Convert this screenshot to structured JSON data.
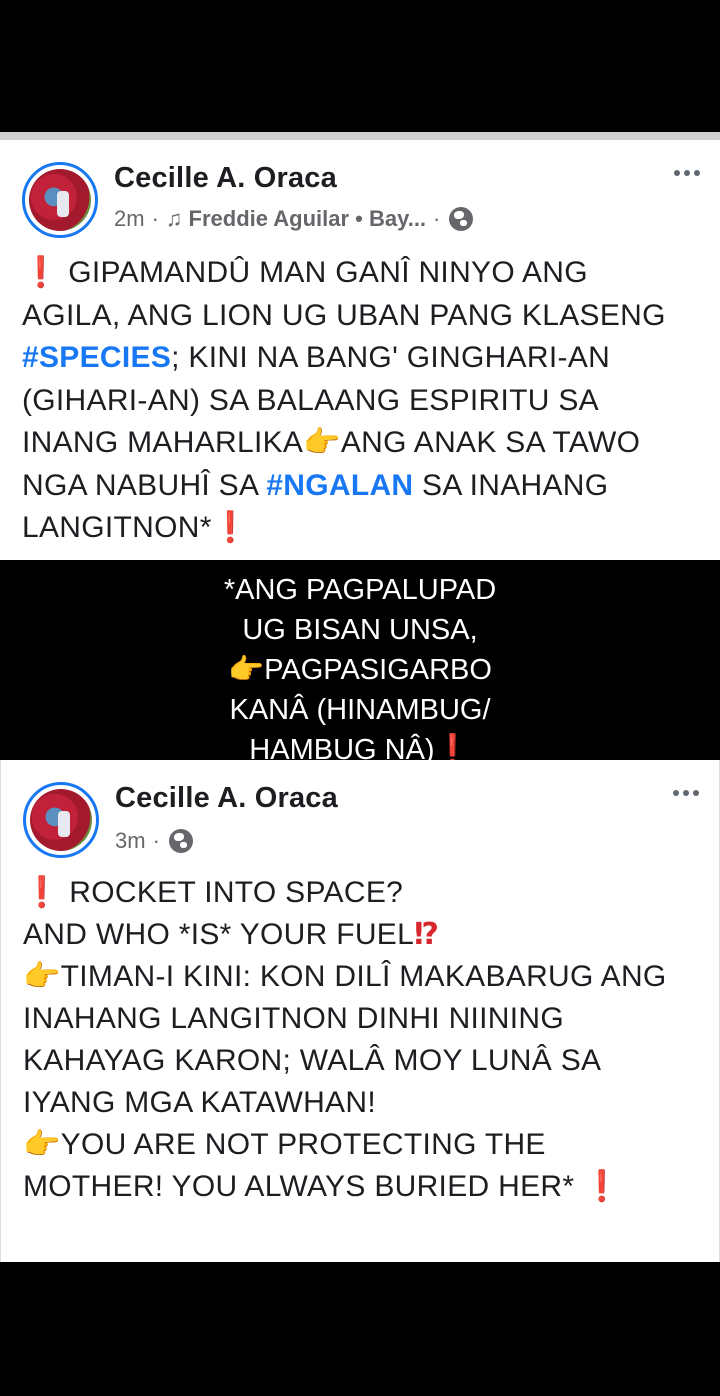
{
  "post1": {
    "author": "Cecille A. Oraca",
    "time": "2m",
    "music_icon": "♫",
    "song": "Freddie Aguilar • Bay...",
    "lines": [
      {
        "parts": [
          {
            "t": "❗",
            "k": "excl"
          },
          {
            "t": " GIPAMANDÛ MAN GANÎ NINYO ANG",
            "k": ""
          }
        ]
      },
      {
        "parts": [
          {
            "t": "AGILA, ANG LION UG UBAN PANG KLASENG",
            "k": ""
          }
        ]
      },
      {
        "parts": [
          {
            "t": "#SPECIES",
            "k": "hash"
          },
          {
            "t": "; KINI NA BANG' GINGHARI-AN",
            "k": ""
          }
        ]
      },
      {
        "parts": [
          {
            "t": "(GIHARI-AN) SA BALAANG ESPIRITU SA",
            "k": ""
          }
        ]
      },
      {
        "parts": [
          {
            "t": "INANG MAHARLIKA👉ANG ANAK SA TAWO",
            "k": ""
          }
        ]
      },
      {
        "parts": [
          {
            "t": "NGA NABUHÎ SA ",
            "k": ""
          },
          {
            "t": "#NGALAN",
            "k": "hash"
          },
          {
            "t": " SA INAHANG",
            "k": ""
          }
        ]
      },
      {
        "parts": [
          {
            "t": "LANGITNON*",
            "k": ""
          },
          {
            "t": "❗",
            "k": "excl"
          }
        ]
      }
    ]
  },
  "caption": {
    "lines": [
      "*ANG PAGPALUPAD",
      "UG BISAN UNSA,",
      "👉PAGPASIGARBO",
      "KANÂ (HINAMBUG/",
      "HAMBUG NÂ)❗"
    ]
  },
  "post2": {
    "author": "Cecille A. Oraca",
    "time": "3m",
    "lines": [
      {
        "parts": [
          {
            "t": "❗",
            "k": "excl"
          },
          {
            "t": " ROCKET INTO SPACE?",
            "k": ""
          }
        ]
      },
      {
        "parts": [
          {
            "t": "AND WHO *IS* YOUR FUEL",
            "k": ""
          },
          {
            "t": "⁉",
            "k": "excl"
          }
        ]
      },
      {
        "parts": [
          {
            "t": "👉TIMAN-I KINI: KON DILÎ MAKABARUG ANG",
            "k": ""
          }
        ]
      },
      {
        "parts": [
          {
            "t": "INAHANG LANGITNON DINHI NIINING",
            "k": ""
          }
        ]
      },
      {
        "parts": [
          {
            "t": "KAHAYAG KARON; WALÂ MOY LUNÂ SA",
            "k": ""
          }
        ]
      },
      {
        "parts": [
          {
            "t": "IYANG MGA KATAWHAN!",
            "k": ""
          }
        ]
      },
      {
        "parts": [
          {
            "t": "👉YOU ARE NOT PROTECTING THE",
            "k": ""
          }
        ]
      },
      {
        "parts": [
          {
            "t": "MOTHER! YOU ALWAYS BURIED HER*",
            "k": ""
          },
          {
            "t": " ❗",
            "k": "excl"
          }
        ]
      }
    ]
  },
  "icons": {
    "more": "more-options-icon",
    "globe": "globe-public-icon",
    "music": "music-note-icon"
  },
  "colors": {
    "hashtag": "#1877f2",
    "exclamation": "#d8262e",
    "meta": "#65676b",
    "text": "#1c1e21"
  }
}
